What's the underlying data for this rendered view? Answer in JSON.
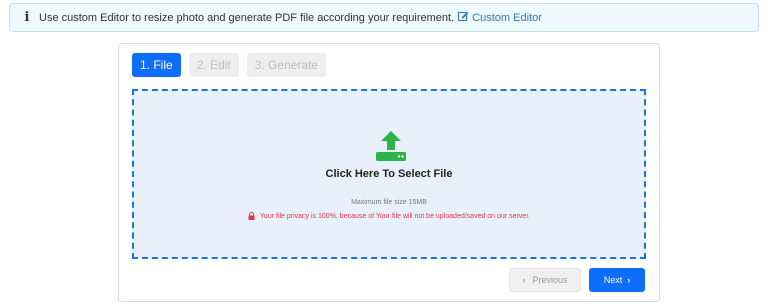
{
  "info": {
    "icon": "info-icon",
    "message": "Use custom Editor to resize photo and generate PDF file according your requirement.",
    "link_label": "Custom Editor",
    "link_icon": "edit-icon"
  },
  "steps": [
    {
      "label": "1. File",
      "active": true
    },
    {
      "label": "2. Edit",
      "active": false
    },
    {
      "label": "3. Generate",
      "active": false
    }
  ],
  "dropzone": {
    "icon": "upload-icon",
    "title": "Click Here To Select File",
    "size_note": "Maximum file size 15MB",
    "privacy_icon": "lock-icon",
    "privacy_note": "Your file privacy is 100%, because of Your file will not be uploaded/saved on our server."
  },
  "nav": {
    "previous_label": "Previous",
    "next_label": "Next",
    "previous_icon": "chevron-left-icon",
    "next_icon": "chevron-right-icon"
  },
  "colors": {
    "primary": "#0d6efd",
    "upload_green": "#2db34a",
    "danger": "#e0354d",
    "dropzone_bg": "#e8f1fb",
    "info_bg": "#eef9fb"
  }
}
